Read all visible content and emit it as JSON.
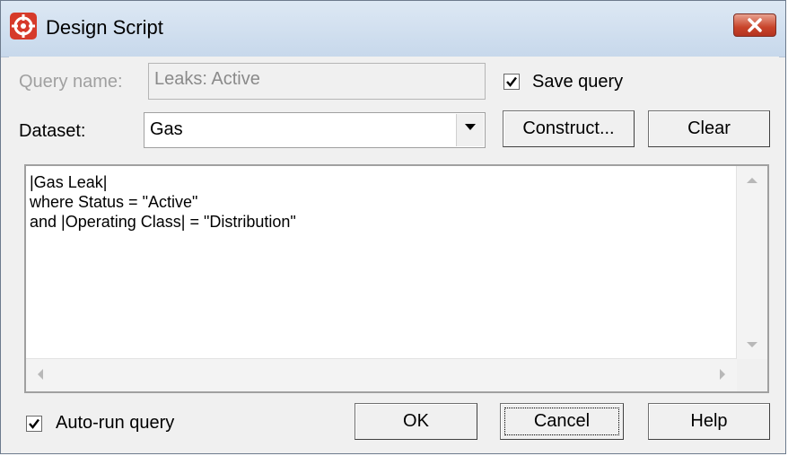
{
  "window": {
    "title": "Design Script",
    "icon": "target-crosshair-icon",
    "close_icon": "close-icon",
    "close_color": "#c8442a"
  },
  "query_name": {
    "label": "Query name:",
    "value": "Leaks: Active",
    "enabled": false
  },
  "save_query": {
    "label": "Save query",
    "checked": true
  },
  "dataset": {
    "label": "Dataset:",
    "value": "Gas"
  },
  "buttons": {
    "construct": "Construct...",
    "clear": "Clear",
    "ok": "OK",
    "cancel": "Cancel",
    "help": "Help"
  },
  "script": {
    "lines": [
      "|Gas Leak|",
      "where Status = \"Active\"",
      "and |Operating Class| = \"Distribution\""
    ]
  },
  "auto_run": {
    "label": "Auto-run query",
    "checked": true
  }
}
